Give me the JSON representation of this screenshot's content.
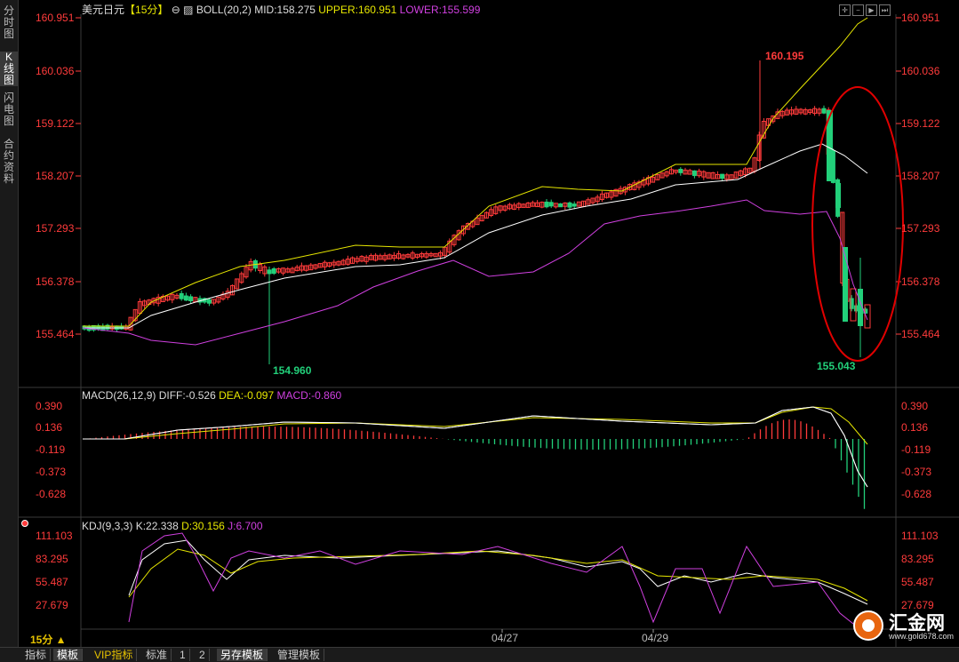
{
  "sidebar": {
    "tabs": [
      {
        "label": [
          "分",
          "时",
          "图"
        ],
        "active": false
      },
      {
        "label": [
          "K",
          "线",
          "图"
        ],
        "active": true
      },
      {
        "label": [
          "闪",
          "电",
          "图"
        ],
        "active": false
      },
      {
        "label": [
          "合",
          "约",
          "资",
          "料"
        ],
        "active": false
      }
    ]
  },
  "main_header": {
    "symbol": "美元日元",
    "period": "【15分】",
    "indicator": "BOLL(20,2)",
    "mid": "MID:158.275",
    "upper": "UPPER:160.951",
    "lower": "LOWER:155.599"
  },
  "price_axis": [
    "160.951",
    "160.036",
    "159.122",
    "158.207",
    "157.293",
    "156.378",
    "155.464"
  ],
  "annotations": {
    "high_label": "160.195",
    "low_label_1": "154.960",
    "low_label_2": "155.043"
  },
  "macd_header": {
    "indicator": "MACD(26,12,9)",
    "diff": "DIFF:-0.526",
    "dea": "DEA:-0.097",
    "macd": "MACD:-0.860"
  },
  "macd_axis": [
    "0.390",
    "0.136",
    "-0.119",
    "-0.373",
    "-0.628"
  ],
  "kdj_header": {
    "indicator": "KDJ(9,3,3)",
    "k": "K:22.338",
    "d": "D:30.156",
    "j": "J:6.700"
  },
  "kdj_axis": [
    "111.103",
    "83.295",
    "55.487",
    "27.679"
  ],
  "period_selector": "15分 ▲",
  "date_labels": [
    "04/27",
    "04/29"
  ],
  "bottom_tabs": [
    "指标",
    "模板",
    "VIP指标",
    "标准",
    "1",
    "2",
    "另存模板",
    "管理模板"
  ],
  "logo": {
    "text": "汇金网",
    "url": "www.gold678.com"
  },
  "colors": {
    "up": "#ff3b3b",
    "down": "#22d07a",
    "boll_upper": "#e6e600",
    "boll_mid": "#ffffff",
    "boll_lower": "#d040e0",
    "highlight": "#e00000"
  },
  "chart_data": [
    {
      "type": "candlestick",
      "title": "美元日元 15分 BOLL(20,2)",
      "ylim": [
        155.0,
        161.0
      ],
      "yticks": [
        160.951,
        160.036,
        159.122,
        158.207,
        157.293,
        156.378,
        155.464
      ],
      "x_labels": [
        "04/27",
        "04/29"
      ],
      "annotated_points": [
        160.195,
        154.96,
        155.043
      ],
      "boll": {
        "mid": 158.275,
        "upper": 160.951,
        "lower": 155.599
      }
    },
    {
      "type": "bar",
      "title": "MACD(26,12,9)",
      "yticks": [
        0.39,
        0.136,
        -0.119,
        -0.373,
        -0.628
      ],
      "values": {
        "diff": -0.526,
        "dea": -0.097,
        "macd": -0.86
      }
    },
    {
      "type": "line",
      "title": "KDJ(9,3,3)",
      "yticks": [
        111.103,
        83.295,
        55.487,
        27.679
      ],
      "values": {
        "k": 22.338,
        "d": 30.156,
        "j": 6.7
      }
    }
  ]
}
